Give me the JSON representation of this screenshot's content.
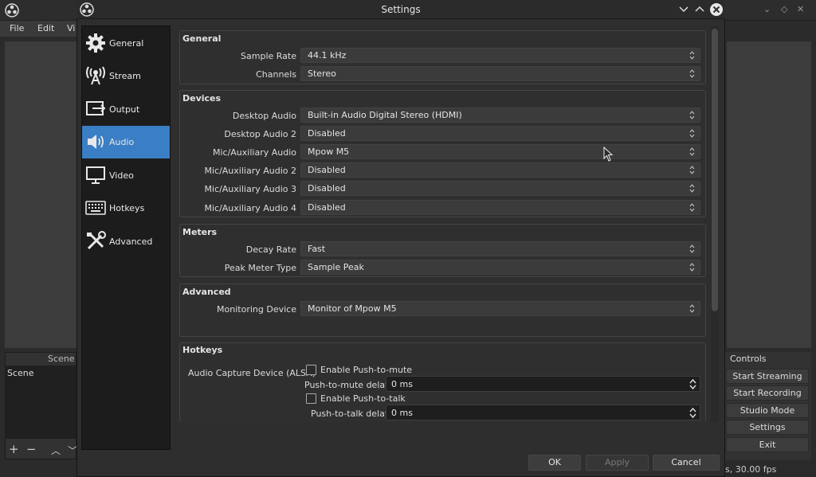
{
  "main": {
    "menu": [
      "File",
      "Edit",
      "Vi"
    ],
    "scenes_title": "Scene",
    "scene_header": "Scene",
    "controls_title": "Controls",
    "controls": [
      "Start Streaming",
      "Start Recording",
      "Studio Mode",
      "Settings",
      "Exit"
    ],
    "fps": "s, 30.00 fps"
  },
  "dialog": {
    "title": "Settings",
    "sidebar": [
      {
        "label": "General",
        "icon": "gear-icon"
      },
      {
        "label": "Stream",
        "icon": "antenna-icon"
      },
      {
        "label": "Output",
        "icon": "output-icon"
      },
      {
        "label": "Audio",
        "icon": "speaker-icon",
        "active": true
      },
      {
        "label": "Video",
        "icon": "monitor-icon"
      },
      {
        "label": "Hotkeys",
        "icon": "keyboard-icon"
      },
      {
        "label": "Advanced",
        "icon": "tools-icon"
      }
    ],
    "groups": {
      "general": {
        "title": "General",
        "sample_rate_label": "Sample Rate",
        "sample_rate": "44.1 kHz",
        "channels_label": "Channels",
        "channels": "Stereo"
      },
      "devices": {
        "title": "Devices",
        "rows": [
          {
            "label": "Desktop Audio",
            "value": "Built-in Audio Digital Stereo (HDMI)"
          },
          {
            "label": "Desktop Audio 2",
            "value": "Disabled"
          },
          {
            "label": "Mic/Auxiliary Audio",
            "value": "Mpow M5"
          },
          {
            "label": "Mic/Auxiliary Audio 2",
            "value": "Disabled"
          },
          {
            "label": "Mic/Auxiliary Audio 3",
            "value": "Disabled"
          },
          {
            "label": "Mic/Auxiliary Audio 4",
            "value": "Disabled"
          }
        ]
      },
      "meters": {
        "title": "Meters",
        "decay_label": "Decay Rate",
        "decay": "Fast",
        "peak_label": "Peak Meter Type",
        "peak": "Sample Peak"
      },
      "advanced": {
        "title": "Advanced",
        "monitor_label": "Monitoring Device",
        "monitor": "Monitor of Mpow M5"
      },
      "hotkeys": {
        "title": "Hotkeys",
        "device_label": "Audio Capture Device (ALSA)",
        "ptm_label": "Enable Push-to-mute",
        "ptm_delay_label": "Push-to-mute delay",
        "ptm_delay": "0 ms",
        "ptt_label": "Enable Push-to-talk",
        "ptt_delay_label": "Push-to-talk delay",
        "ptt_delay": "0 ms"
      }
    },
    "buttons": {
      "ok": "OK",
      "apply": "Apply",
      "cancel": "Cancel"
    }
  }
}
